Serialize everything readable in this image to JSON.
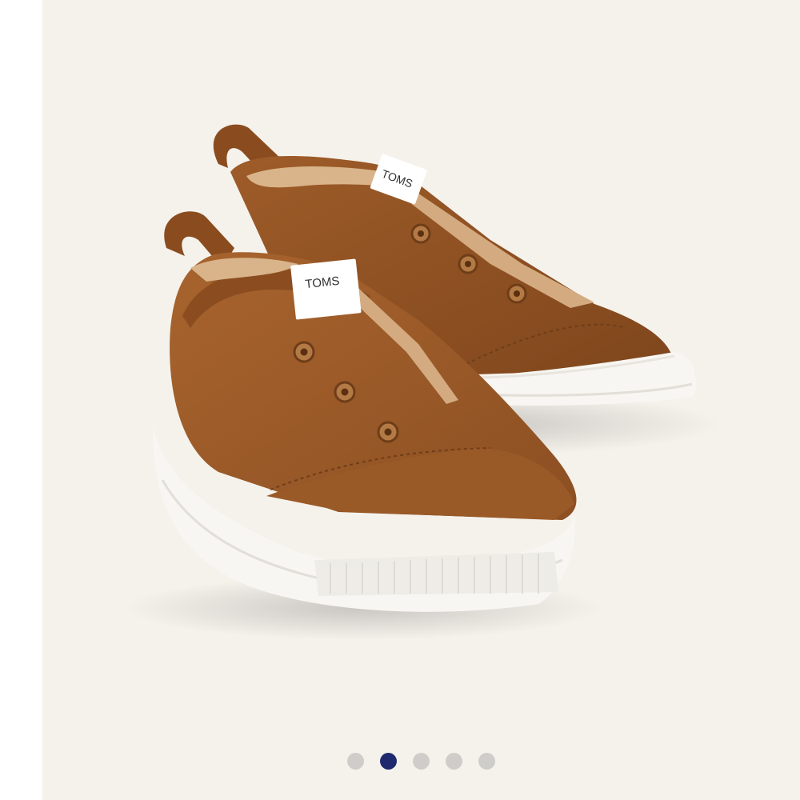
{
  "gallery": {
    "background": "#f5f2ec",
    "image": {
      "subject": "shoe-pair",
      "brand_label": "TOMS",
      "brand_mark": "®",
      "colors": {
        "leather": "#9a5a28",
        "leather_dark": "#6e3d18",
        "lining": "#d9b48a",
        "sole": "#f7f6f2",
        "eyelet": "#b47a45"
      }
    },
    "carousel": {
      "total": 5,
      "active_index": 1,
      "active_color": "#1f2a6e",
      "inactive_color": "#cfcdca",
      "dots": [
        {
          "name": "carousel-dot-1",
          "active": false
        },
        {
          "name": "carousel-dot-2",
          "active": true
        },
        {
          "name": "carousel-dot-3",
          "active": false
        },
        {
          "name": "carousel-dot-4",
          "active": false
        },
        {
          "name": "carousel-dot-5",
          "active": false
        }
      ]
    }
  }
}
